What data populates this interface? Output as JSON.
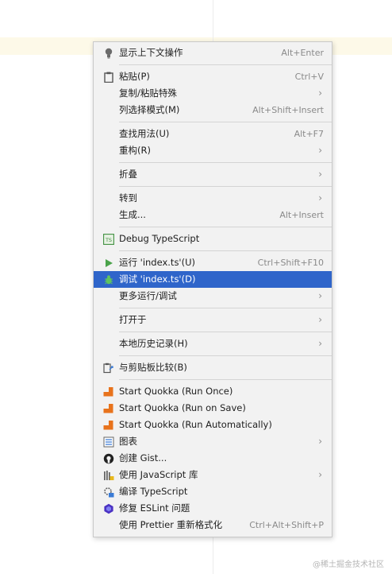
{
  "menu": {
    "items": [
      {
        "label": "显示上下文操作",
        "shortcut": "Alt+Enter",
        "icon": "bulb-icon"
      },
      {
        "label": "粘贴(P)",
        "shortcut": "Ctrl+V",
        "icon": "clipboard-icon"
      },
      {
        "label": "复制/粘贴特殊",
        "shortcut": "",
        "submenu": true
      },
      {
        "label": "列选择模式(M)",
        "shortcut": "Alt+Shift+Insert"
      },
      {
        "label": "查找用法(U)",
        "shortcut": "Alt+F7"
      },
      {
        "label": "重构(R)",
        "submenu": true
      },
      {
        "label": "折叠",
        "submenu": true
      },
      {
        "label": "转到",
        "submenu": true
      },
      {
        "label": "生成...",
        "shortcut": "Alt+Insert"
      },
      {
        "label": "Debug TypeScript",
        "icon": "typescript-icon"
      },
      {
        "label": "运行 'index.ts'(U)",
        "shortcut": "Ctrl+Shift+F10",
        "icon": "run-icon"
      },
      {
        "label": "调试 'index.ts'(D)",
        "icon": "debug-bug-icon",
        "selected": true
      },
      {
        "label": "更多运行/调试",
        "submenu": true
      },
      {
        "label": "打开于",
        "submenu": true
      },
      {
        "label": "本地历史记录(H)",
        "submenu": true
      },
      {
        "label": "与剪贴板比较(B)",
        "icon": "compare-clipboard-icon"
      },
      {
        "label": "Start Quokka (Run Once)",
        "icon": "quokka-icon"
      },
      {
        "label": "Start Quokka (Run on Save)",
        "icon": "quokka-icon"
      },
      {
        "label": "Start Quokka (Run Automatically)",
        "icon": "quokka-icon"
      },
      {
        "label": "图表",
        "submenu": true,
        "icon": "diagram-icon"
      },
      {
        "label": "创建 Gist...",
        "icon": "github-icon"
      },
      {
        "label": "使用 JavaScript 库",
        "submenu": true,
        "icon": "js-library-icon"
      },
      {
        "label": "编译 TypeScript",
        "icon": "ts-compile-icon"
      },
      {
        "label": "修复 ESLint 问题",
        "icon": "eslint-icon"
      },
      {
        "label": "使用 Prettier 重新格式化",
        "shortcut": "Ctrl+Alt+Shift+P"
      }
    ]
  },
  "watermark": "@稀土掘金技术社区",
  "colors": {
    "selection": "#2f65ca",
    "menu_bg": "#f2f2f2",
    "quokka": "#e8731c",
    "run_green": "#4aa34a",
    "eslint_purple": "#4b32c3"
  }
}
